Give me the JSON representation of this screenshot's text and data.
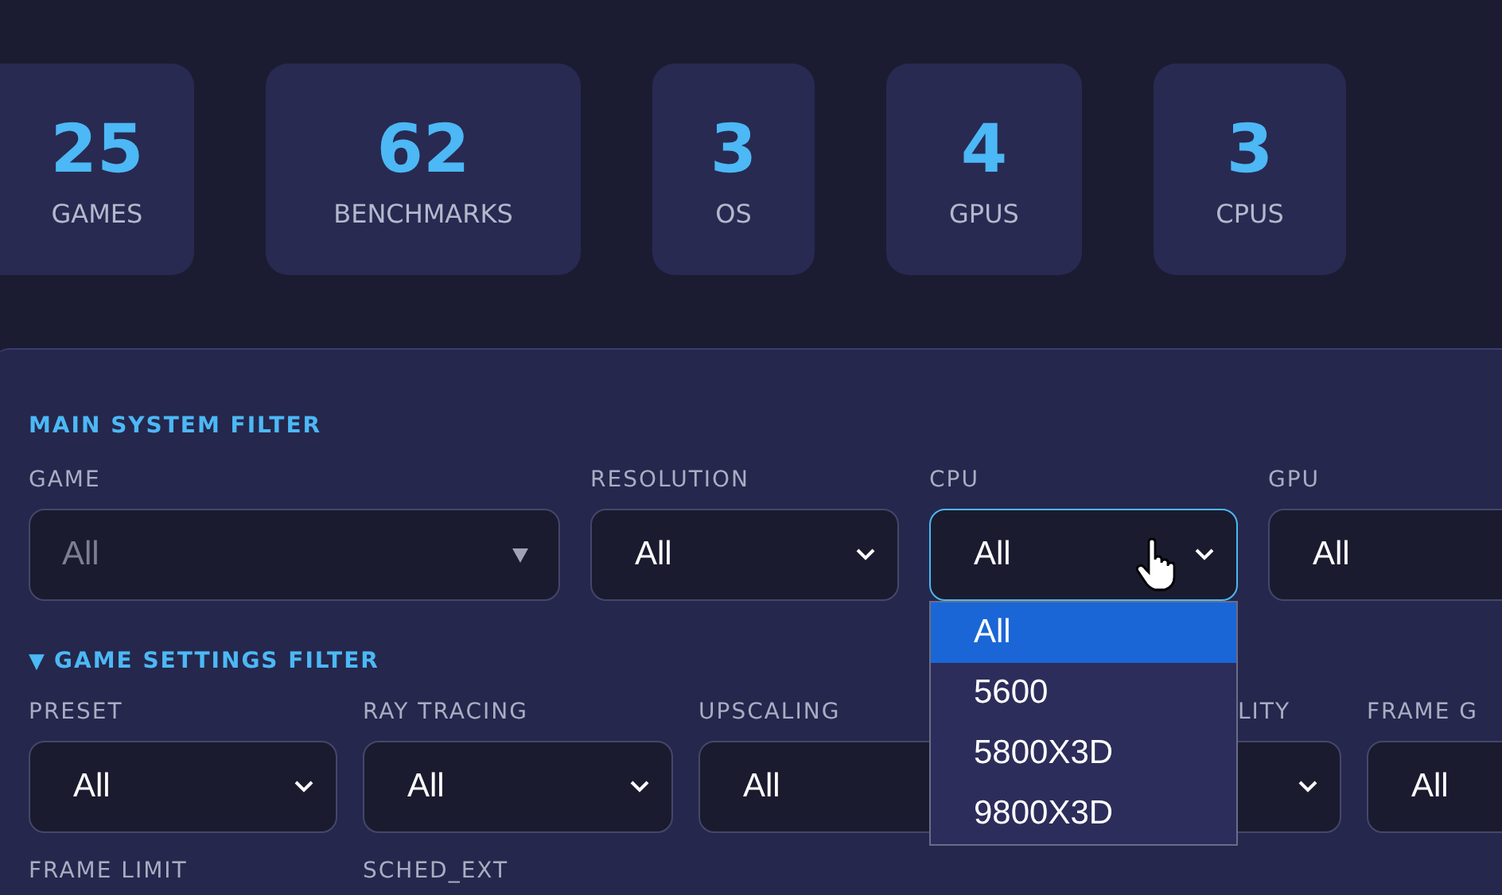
{
  "stats": [
    {
      "value": "25",
      "label": "GAMES"
    },
    {
      "value": "62",
      "label": "BENCHMARKS"
    },
    {
      "value": "3",
      "label": "OS"
    },
    {
      "value": "4",
      "label": "GPUS"
    },
    {
      "value": "3",
      "label": "CPUS"
    }
  ],
  "main_filter": {
    "title": "MAIN SYSTEM FILTER",
    "fields": [
      {
        "kind": "combo",
        "label": "GAME",
        "placeholder": "All"
      },
      {
        "kind": "select",
        "label": "RESOLUTION",
        "value": "All",
        "focused": false
      },
      {
        "kind": "select",
        "label": "CPU",
        "value": "All",
        "focused": true,
        "options": [
          {
            "label": "All",
            "selected": true
          },
          {
            "label": "5600",
            "selected": false
          },
          {
            "label": "5800X3D",
            "selected": false
          },
          {
            "label": "9800X3D",
            "selected": false
          }
        ]
      },
      {
        "kind": "select",
        "label": "GPU",
        "value": "All",
        "focused": false
      }
    ]
  },
  "settings_filter": {
    "toggle": "▼",
    "title": "GAME SETTINGS FILTER",
    "expanded": true,
    "fields": [
      {
        "kind": "select",
        "label": "PRESET",
        "value": "All",
        "focused": false
      },
      {
        "kind": "select",
        "label": "RAY TRACING",
        "value": "All",
        "focused": false
      },
      {
        "kind": "select",
        "label": "UPSCALING",
        "value": "All",
        "focused": false
      },
      {
        "kind": "select",
        "label": "LITY",
        "focused": false,
        "label_covered": true
      },
      {
        "kind": "select",
        "label": "FRAME G",
        "value": "All",
        "focused": false
      }
    ],
    "more_fields": [
      {
        "label": "FRAME LIMIT"
      },
      {
        "label": "SCHED_EXT"
      }
    ]
  }
}
